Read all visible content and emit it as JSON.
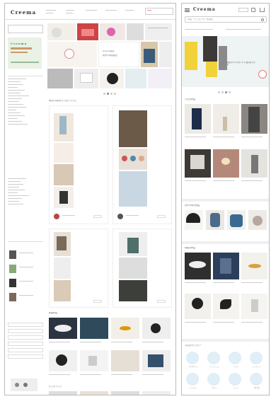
{
  "desktop": {
    "logo": "Creema",
    "banner_text_1": "Creema限定",
    "banner_text_2": "新作＆特別販売",
    "section_feed_title": "あなたの好きそうなアイテム",
    "section_new_title": "新着作品",
    "section_bottom_title": "ピックアップ"
  },
  "mobile": {
    "logo": "Creema",
    "search_placeholder": "作品・クリエイターを検索",
    "hero_caption": "作家のテキスタイルで 夏のおでかけ",
    "section_1_title": "人気の作品",
    "section_2_title": "おすすめの作品",
    "section_3_title": "新着の作品",
    "section_4_title": "人気のカテゴリー",
    "category_labels": [
      "アクセサリー",
      "ファッション",
      "バッグ",
      "インテリア",
      "キッチン",
      "ベビー",
      "ペット",
      "食べ物"
    ]
  }
}
